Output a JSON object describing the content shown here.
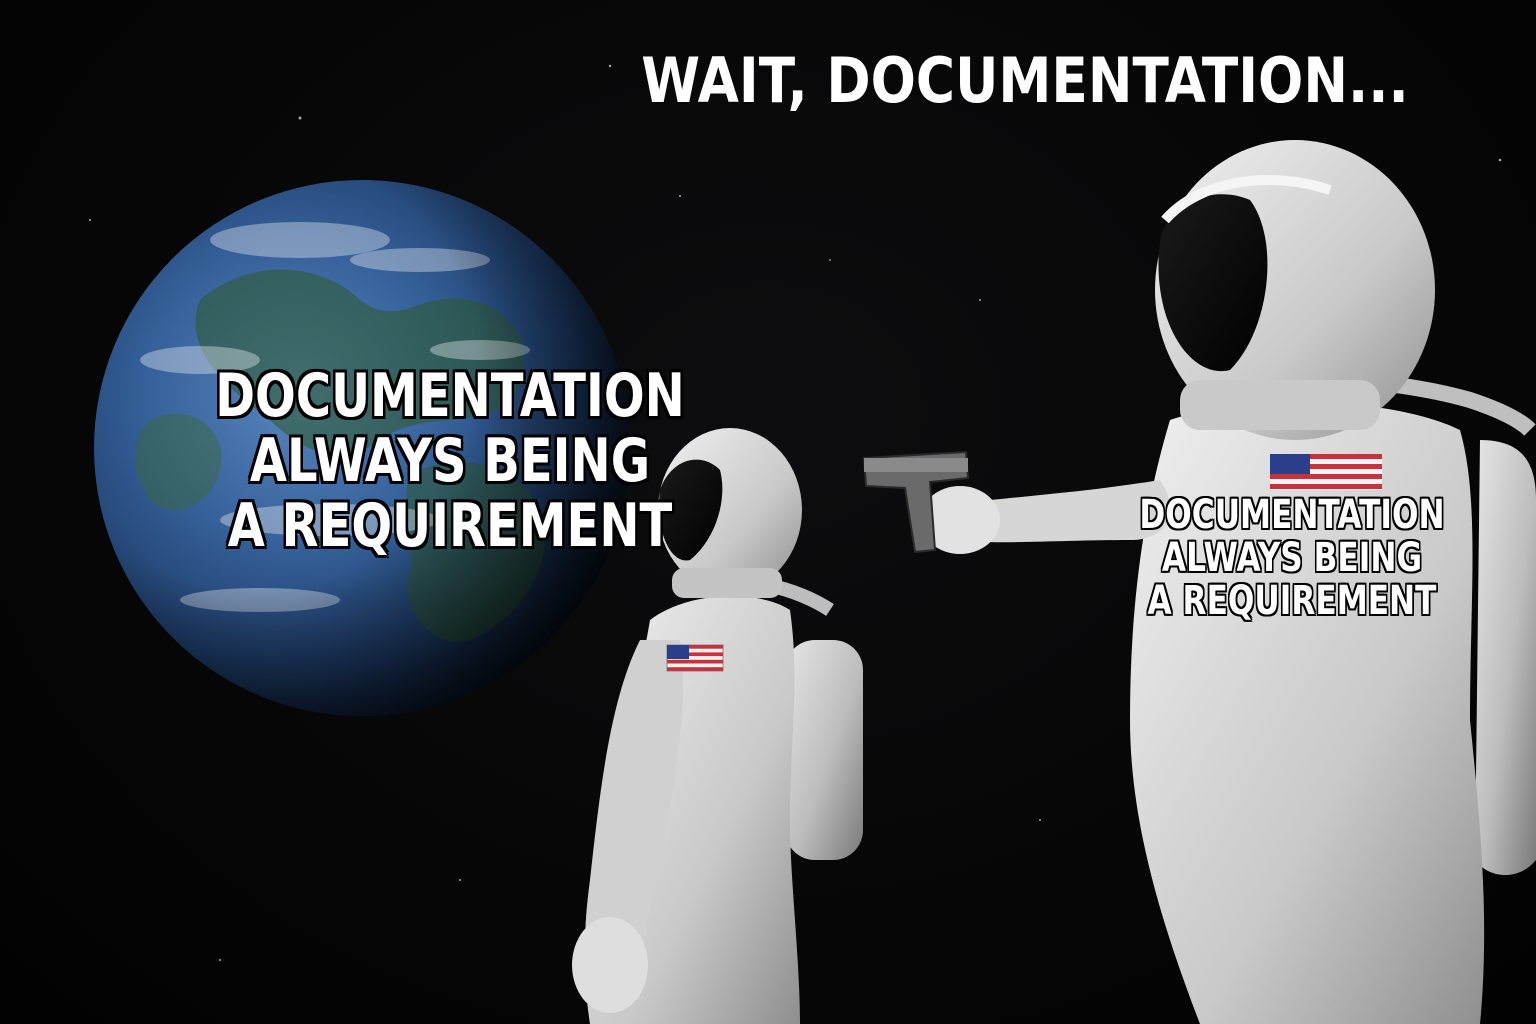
{
  "meme": {
    "top_caption": "WAIT, DOCUMENTATION...",
    "earth_caption": "DOCUMENTATION\nALWAYS BEING\nA REQUIREMENT",
    "astronaut_caption": "DOCUMENTATION\nALWAYS BEING\nA REQUIREMENT"
  },
  "colors": {
    "space": "#050505",
    "ocean": "#2f5f9e",
    "land": "#2e5a2a",
    "suit": "#d8d8d8",
    "flag_red": "#c8323c",
    "flag_blue": "#2a3f8a"
  },
  "icons": {
    "earth": "earth-illustration",
    "astronaut_front": "astronaut-illustration",
    "astronaut_back": "astronaut-with-gun-illustration",
    "gun": "pistol-illustration"
  }
}
